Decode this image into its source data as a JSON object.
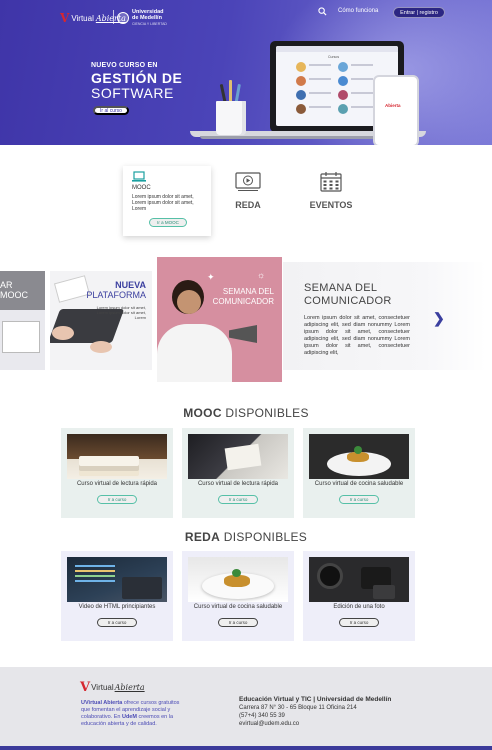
{
  "header": {
    "logo_brand_a": "Virtual",
    "logo_brand_b": "Abierta",
    "logo_udem_line1": "Universidad",
    "logo_udem_line2": "de Medellín",
    "logo_udem_tagline": "CIENCIA Y LIBERTAD",
    "nav_link": "Cómo funciona",
    "login_button": "Entrar | registro"
  },
  "hero": {
    "subtitle": "NUEVO CURSO EN",
    "title_line1": "GESTIÓN DE",
    "title_line2": "SOFTWARE",
    "button": "Ir al curso",
    "screen_title": "Cursos"
  },
  "features": {
    "mooc": {
      "label": "MOOC",
      "description": "Lorem ipsum dolor sit amet, Lorem ipsum dolor sit amet, Lorem",
      "button": "Ir a MOOC"
    },
    "reda": {
      "label": "REDA"
    },
    "eventos": {
      "label": "EVENTOS"
    }
  },
  "carousel": {
    "left_card_title_a": "AR",
    "left_card_title_b": "MOOC",
    "mid_card_title_a": "NUEVA",
    "mid_card_title_b": "PLATAFORMA",
    "mid_card_desc": "Lorem ipsum dolor sit amet, Lorem ipsum dolor sit amet, Lorem",
    "main_card_title_a": "SEMANA DEL",
    "main_card_title_b": "COMUNICADOR",
    "info_title_a": "SEMANA DEL",
    "info_title_b": "COMUNICADOR",
    "info_desc": "Lorem ipsum dolor sit amet, consectetuer adipiscing elit, sed diam nonummy Lorem ipsum dolor sit amet, consectetuer adipiscing elit, sed diam nonummy Lorem ipsum dolor sit amet, consectetuer adipiscing elit,",
    "next_arrow": "❯"
  },
  "mooc_section": {
    "title_bold": "MOOC",
    "title_rest": "DISPONIBLES",
    "cards": [
      {
        "name": "Curso virtual de lectura rápida",
        "button": "Ir a curso"
      },
      {
        "name": "Curso virtual de lectura rápida",
        "button": "Ir a curso"
      },
      {
        "name": "Curso virtual de cocina saludable",
        "button": "Ir a curso"
      }
    ]
  },
  "reda_section": {
    "title_bold": "REDA",
    "title_rest": "DISPONIBLES",
    "cards": [
      {
        "name": "Video de HTML principiantes",
        "button": "Ir a curso"
      },
      {
        "name": "Curso virtual de cocina saludable",
        "button": "Ir a curso"
      },
      {
        "name": "Edición de una foto",
        "button": "Ir a curso"
      }
    ]
  },
  "footer": {
    "logo_a": "Virtual",
    "logo_b": "Abierta",
    "desc_brand": "UVirtual Abierta",
    "desc_part1": " ofrece cursos gratuitos que fomentan el aprendizaje social y colaborativo. En ",
    "desc_udem": "UdeM",
    "desc_part2": " creemos en la educación abierta y de calidad.",
    "contact_heading": "Educación Virtual y TIC | Universidad de Medellín",
    "address": "Carrera 87 N° 30 - 65 Bloque 11 Oficina 214",
    "phone": "(57+4) 340 55 39",
    "email": "evirtual@udem.edu.co"
  },
  "colors": {
    "hero_primary": "#3f35a8",
    "accent_teal": "#56c0a7",
    "brand_red": "#d6262f",
    "footer_bar": "#3b3a9a"
  }
}
